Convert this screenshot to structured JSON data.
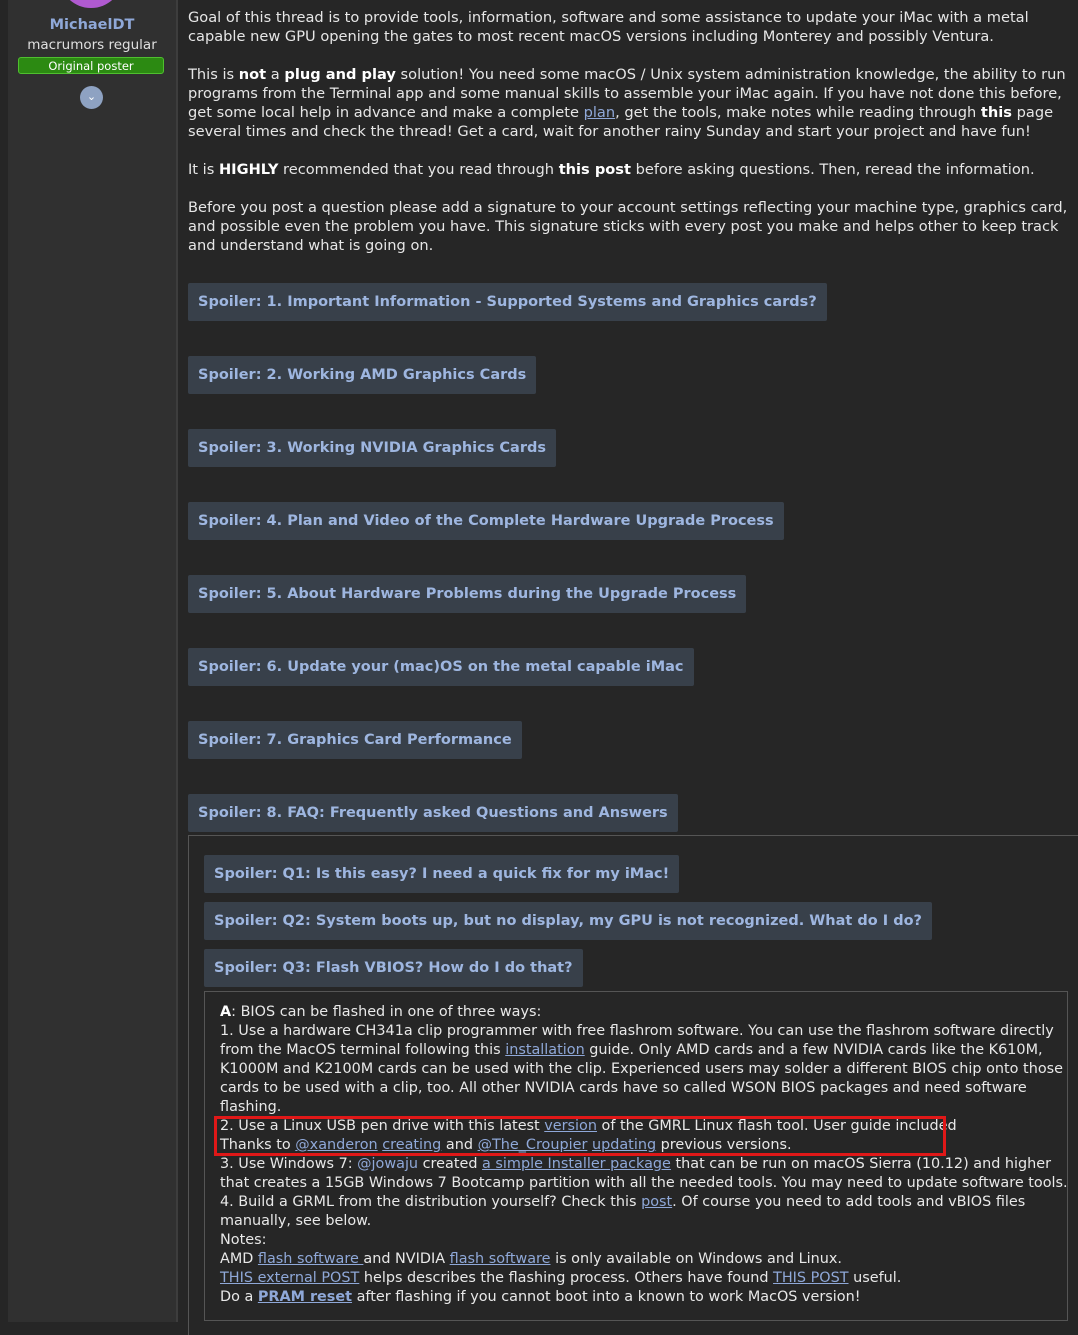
{
  "user": {
    "name": "MichaelDT",
    "title": "macrumors regular",
    "badge": "Original poster",
    "expand_icon": "chevron-down-icon"
  },
  "post": {
    "p1": "Goal of this thread is to provide tools, information, software and some assistance to update your iMac with a metal capable new GPU opening the gates to most recent macOS versions including Monterey and possibly Ventura.",
    "p2": {
      "a": "This is ",
      "not": "not",
      "b": " a ",
      "plug": "plug and play",
      "c": " solution! You need some macOS / Unix system administration knowledge, the ability to run programs from the Terminal app and some manual skills to assemble your iMac again. If you have not done this before, get some local help in advance and make a complete ",
      "plan_link": "plan",
      "d": ", get the tools, make notes while reading through ",
      "this": "this",
      "e": " page several times and check the thread! Get a card, wait for another rainy Sunday and start your project and have fun!"
    },
    "p3": {
      "a": "It is ",
      "highly": "HIGHLY",
      "b": " recommended that you read through ",
      "this_post": "this post",
      "c": " before asking questions. Then, reread the information."
    },
    "p4": "Before you post a question please add a signature to your account settings reflecting your machine type, graphics card, and possible even the problem you have. This signature sticks with every post you make and helps other to keep track and understand what is going on."
  },
  "spoilers": [
    "Spoiler: 1. Important Information - Supported Systems and Graphics cards?",
    "Spoiler: 2. Working AMD Graphics Cards",
    "Spoiler: 3. Working NVIDIA Graphics Cards",
    "Spoiler: 4. Plan and Video of the Complete Hardware Upgrade Process",
    "Spoiler: 5. About Hardware Problems during the Upgrade Process",
    "Spoiler: 6. Update your (mac)OS on the metal capable iMac",
    "Spoiler: 7. Graphics Card Performance",
    "Spoiler: 8. FAQ: Frequently asked Questions and Answers"
  ],
  "faq": [
    "Spoiler: Q1: Is this easy? I need a quick fix for my iMac!",
    "Spoiler: Q2: System boots up, but no display, my GPU is not recognized. What do I do?",
    "Spoiler: Q3: Flash VBIOS? How do I do that?"
  ],
  "answer": {
    "l1a": "A",
    "l1b": ": BIOS can be flashed in one of three ways:",
    "l2": "1. Use a hardware CH341a clip programmer with free flashrom software. You can use the flashrom software directly",
    "l3a": "from the MacOS terminal following this ",
    "l3link": "installation",
    "l3b": " guide. Only AMD cards and a few NVIDIA cards like the K610M,",
    "l4": "K1000M and K2100M cards can be used with the clip. Experienced users may solder a different BIOS chip onto those",
    "l5": "cards to be used with a clip, too. All other NVIDIA cards have so called WSON BIOS packages and need software",
    "l6": "flashing.",
    "l7a": "2. Use a Linux USB pen drive with this latest ",
    "l7link": "version",
    "l7b": " of the GMRL Linux flash tool. User guide included",
    "l8a": "Thanks to ",
    "l8u1": "@xanderon",
    "l8sp1": " ",
    "l8l1": "creating",
    "l8b": " and ",
    "l8u2": "@The_Croupier",
    "l8sp2": " ",
    "l8l2": "updating",
    "l8c": " previous versions.",
    "l9a": "3. Use Windows 7: ",
    "l9u": "@jowaju",
    "l9b": " created ",
    "l9link": "a simple Installer package",
    "l9c": " that can be run on macOS Sierra (10.12) and higher",
    "l10": "that creates a 15GB Windows 7 Bootcamp partition with all the needed tools. You may need to update software tools.",
    "l11a": "4. Build a GRML from the distribution yourself? Check this ",
    "l11link": "post",
    "l11b": ". Of course you need to add tools and vBIOS files",
    "l12": "manually, see below.",
    "l13": "Notes:",
    "l14a": "AMD ",
    "l14link1": "flash software ",
    "l14b": "and NVIDIA ",
    "l14link2": "flash software",
    "l14c": " is only available on Windows and Linux.",
    "l15link1": "THIS external POST",
    "l15a": " helps describes the flashing process. Others have found ",
    "l15link2": "THIS POST",
    "l15b": " useful.",
    "l16a": "Do a ",
    "l16link": "PRAM reset",
    "l16b": " after flashing if you cannot boot into a known to work MacOS version!"
  },
  "colors": {
    "background": "#262626",
    "link": "#8fa8d8",
    "spoiler_bg": "#38404a",
    "badge_green": "#2c8a12",
    "highlight_red": "#e01818"
  }
}
